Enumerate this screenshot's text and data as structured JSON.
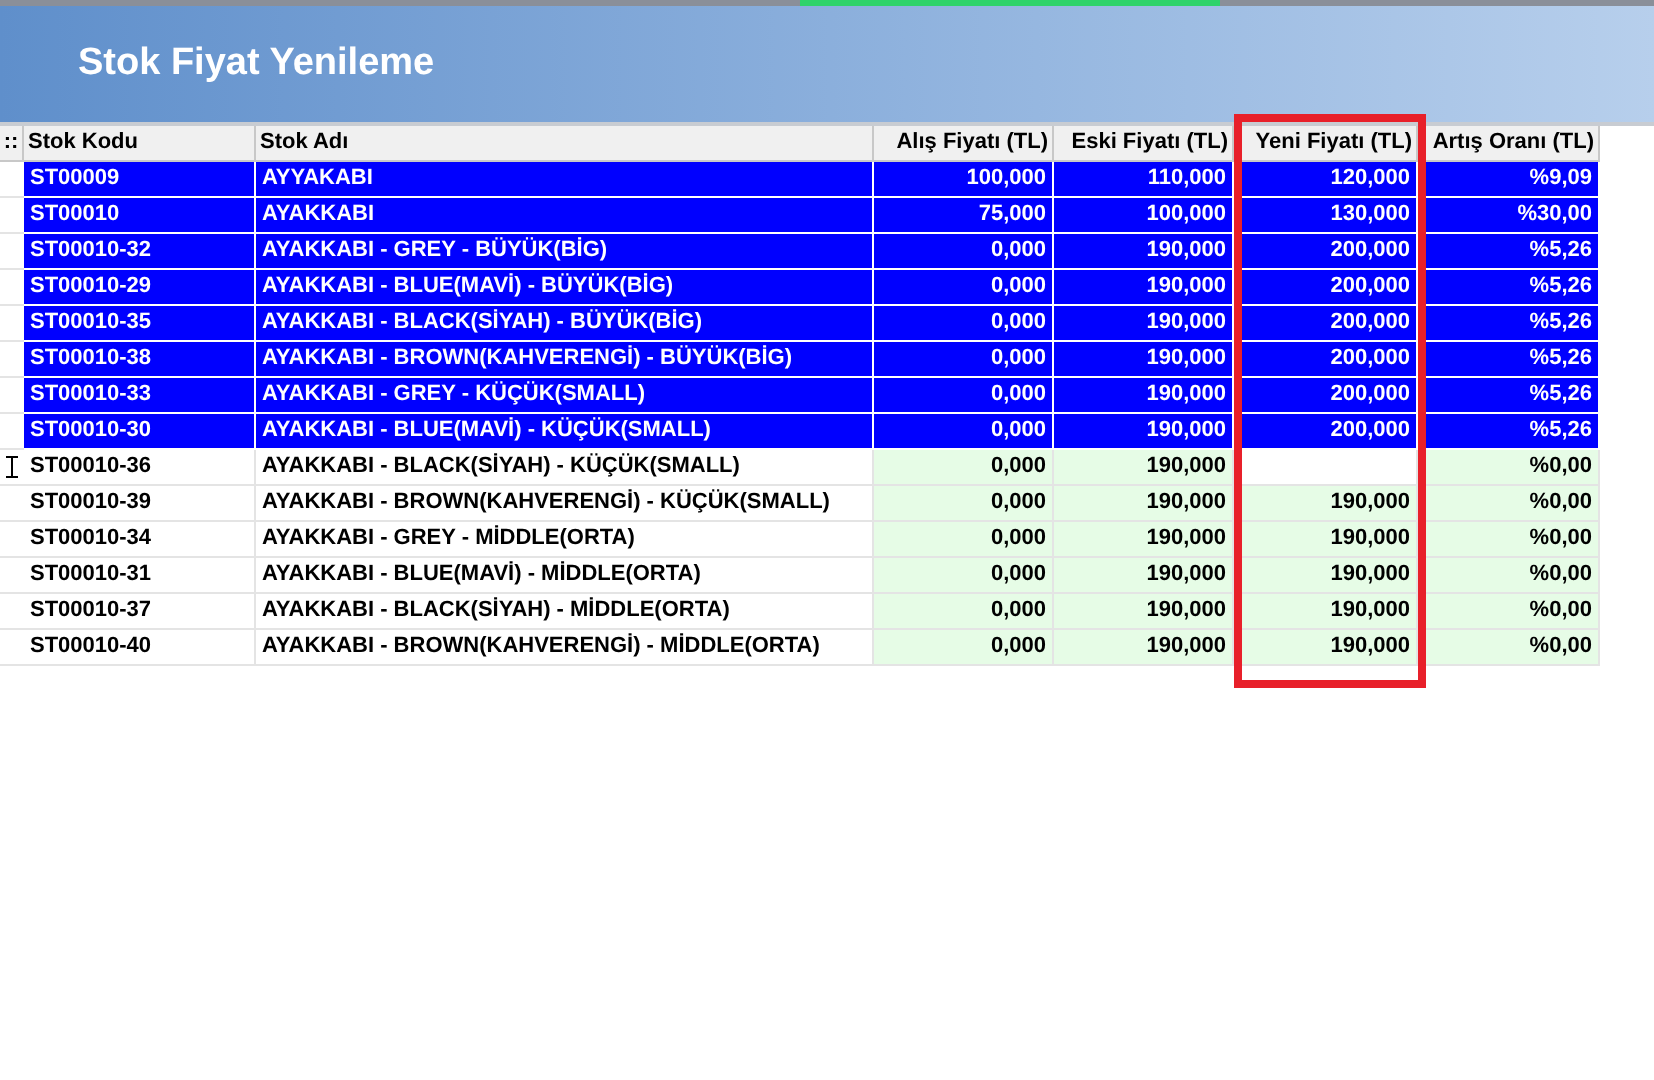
{
  "window": {
    "title": "Stok Fiyat Yenileme"
  },
  "table": {
    "row_marker_header": "::",
    "columns": [
      "Stok Kodu",
      "Stok Adı",
      "Alış Fiyatı (TL)",
      "Eski Fiyatı (TL)",
      "Yeni Fiyatı (TL)",
      "Artış Oranı (TL)"
    ],
    "rows": [
      {
        "code": "ST00009",
        "name": "AYYAKABI",
        "purchase": "100,000",
        "old_price": "110,000",
        "new_price": "120,000",
        "rate": "%9,09",
        "selected": true,
        "editing": false
      },
      {
        "code": "ST00010",
        "name": "AYAKKABI",
        "purchase": "75,000",
        "old_price": "100,000",
        "new_price": "130,000",
        "rate": "%30,00",
        "selected": true,
        "editing": false
      },
      {
        "code": "ST00010-32",
        "name": "AYAKKABI - GREY - BÜYÜK(BİG)",
        "purchase": "0,000",
        "old_price": "190,000",
        "new_price": "200,000",
        "rate": "%5,26",
        "selected": true,
        "editing": false
      },
      {
        "code": "ST00010-29",
        "name": "AYAKKABI - BLUE(MAVİ) - BÜYÜK(BİG)",
        "purchase": "0,000",
        "old_price": "190,000",
        "new_price": "200,000",
        "rate": "%5,26",
        "selected": true,
        "editing": false
      },
      {
        "code": "ST00010-35",
        "name": "AYAKKABI - BLACK(SİYAH) - BÜYÜK(BİG)",
        "purchase": "0,000",
        "old_price": "190,000",
        "new_price": "200,000",
        "rate": "%5,26",
        "selected": true,
        "editing": false
      },
      {
        "code": "ST00010-38",
        "name": "AYAKKABI - BROWN(KAHVERENGİ) - BÜYÜK(BİG)",
        "purchase": "0,000",
        "old_price": "190,000",
        "new_price": "200,000",
        "rate": "%5,26",
        "selected": true,
        "editing": false
      },
      {
        "code": "ST00010-33",
        "name": "AYAKKABI - GREY - KÜÇÜK(SMALL)",
        "purchase": "0,000",
        "old_price": "190,000",
        "new_price": "200,000",
        "rate": "%5,26",
        "selected": true,
        "editing": false
      },
      {
        "code": "ST00010-30",
        "name": "AYAKKABI - BLUE(MAVİ) - KÜÇÜK(SMALL)",
        "purchase": "0,000",
        "old_price": "190,000",
        "new_price": "200,000",
        "rate": "%5,26",
        "selected": true,
        "editing": false
      },
      {
        "code": "ST00010-36",
        "name": "AYAKKABI - BLACK(SİYAH) - KÜÇÜK(SMALL)",
        "purchase": "0,000",
        "old_price": "190,000",
        "rate": "%0,00",
        "selected": false,
        "editing": true
      },
      {
        "code": "ST00010-39",
        "name": "AYAKKABI - BROWN(KAHVERENGİ) - KÜÇÜK(SMALL)",
        "purchase": "0,000",
        "old_price": "190,000",
        "new_price": "190,000",
        "rate": "%0,00",
        "selected": false,
        "editing": false
      },
      {
        "code": "ST00010-34",
        "name": "AYAKKABI - GREY - MİDDLE(ORTA)",
        "purchase": "0,000",
        "old_price": "190,000",
        "new_price": "190,000",
        "rate": "%0,00",
        "selected": false,
        "editing": false
      },
      {
        "code": "ST00010-31",
        "name": "AYAKKABI - BLUE(MAVİ) - MİDDLE(ORTA)",
        "purchase": "0,000",
        "old_price": "190,000",
        "new_price": "190,000",
        "rate": "%0,00",
        "selected": false,
        "editing": false
      },
      {
        "code": "ST00010-37",
        "name": "AYAKKABI - BLACK(SİYAH) - MİDDLE(ORTA)",
        "purchase": "0,000",
        "old_price": "190,000",
        "new_price": "190,000",
        "rate": "%0,00",
        "selected": false,
        "editing": false
      },
      {
        "code": "ST00010-40",
        "name": "AYAKKABI - BROWN(KAHVERENGİ) - MİDDLE(ORTA)",
        "purchase": "0,000",
        "old_price": "190,000",
        "new_price": "190,000",
        "rate": "%0,00",
        "selected": false,
        "editing": false
      }
    ]
  }
}
